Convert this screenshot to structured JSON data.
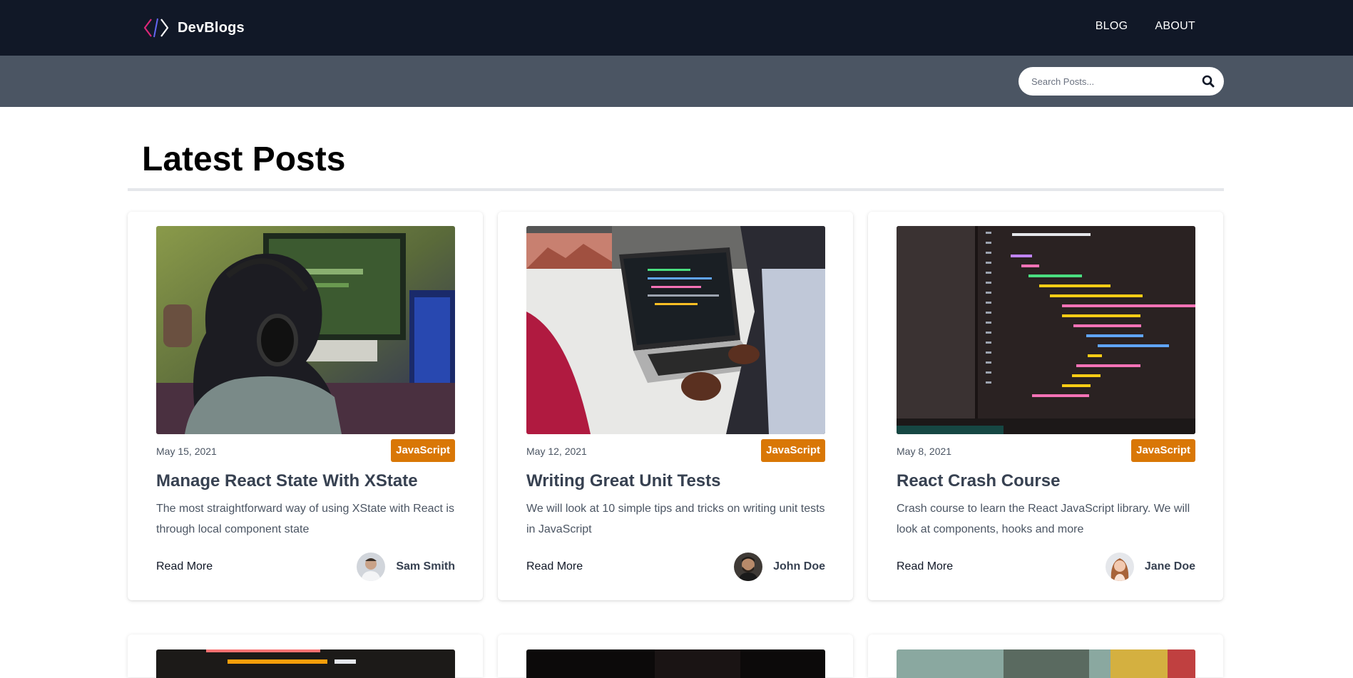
{
  "header": {
    "brand": "DevBlogs",
    "nav": [
      {
        "label": "BLOG"
      },
      {
        "label": "ABOUT"
      }
    ]
  },
  "search": {
    "placeholder": "Search Posts..."
  },
  "main": {
    "title": "Latest Posts",
    "posts": [
      {
        "date": "May 15, 2021",
        "category": "JavaScript",
        "title": "Manage React State With XState",
        "excerpt": "The most straightforward way of using XState with React is through local component state",
        "read_more": "Read More",
        "author": "Sam Smith",
        "image": "person-with-headphones-at-computer"
      },
      {
        "date": "May 12, 2021",
        "category": "JavaScript",
        "title": "Writing Great Unit Tests",
        "excerpt": "We will look at 10 simple tips and tricks on writing unit tests in JavaScript",
        "read_more": "Read More",
        "author": "John Doe",
        "image": "hands-typing-on-laptop"
      },
      {
        "date": "May 8, 2021",
        "category": "JavaScript",
        "title": "React Crash Course",
        "excerpt": "Crash course to learn the React JavaScript library. We will look at components, hooks and more",
        "read_more": "Read More",
        "author": "Jane Doe",
        "image": "react-code-on-screen"
      }
    ]
  },
  "colors": {
    "nav_bg": "#111827",
    "search_band_bg": "#4b5563",
    "tag_bg": "#d97706",
    "brand_accent": "#ec4899"
  },
  "icons": {
    "brand_logo": "code-brackets-icon",
    "search": "search-icon"
  }
}
